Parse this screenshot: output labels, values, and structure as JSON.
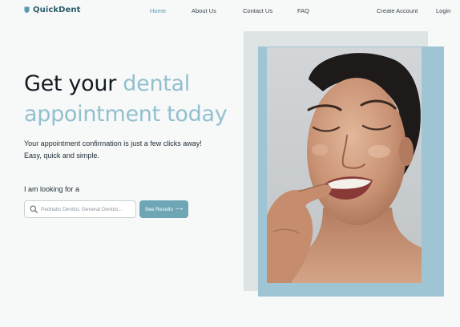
{
  "nav": {
    "logo_text": "QuickDent",
    "home": "Home",
    "about": "About Us",
    "contact": "Contact Us",
    "faq": "FAQ",
    "create_account": "Create Account",
    "login": "Login"
  },
  "hero": {
    "title_part1": "Get your ",
    "title_accent1": "dental",
    "title_accent2": "appointment today",
    "subtitle_line1": "Your appointment confirmation is just a few clicks away!",
    "subtitle_line2": "Easy, quick and simple."
  },
  "search": {
    "label": "I am looking for a",
    "placeholder": "Pedriatic Dentist, General Dentist...",
    "button_label": "See Results",
    "button_arrow": "⟶"
  },
  "colors": {
    "accent": "#93bfcf",
    "button": "#6fa6b5",
    "brand": "#2c5b6b",
    "background": "#f6f9f8"
  }
}
